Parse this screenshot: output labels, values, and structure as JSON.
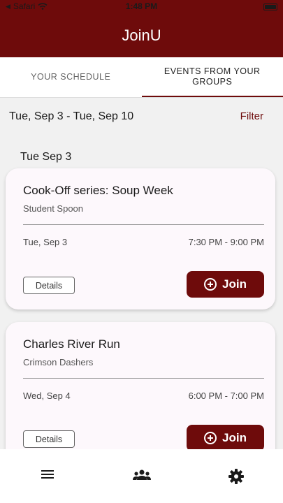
{
  "status_bar": {
    "carrier": "Safari",
    "time": "1:48 PM"
  },
  "header": {
    "title": "JoinU"
  },
  "tabs": [
    {
      "label": "YOUR SCHEDULE",
      "active": false
    },
    {
      "label": "EVENTS FROM YOUR GROUPS",
      "active": true
    }
  ],
  "range": {
    "label": "Tue, Sep 3 - Tue, Sep 10",
    "filter_label": "Filter"
  },
  "day_label": "Tue Sep 3",
  "events": [
    {
      "title": "Cook-Off series: Soup Week",
      "group": "Student Spoon",
      "date": "Tue, Sep 3",
      "time": "7:30 PM - 9:00 PM",
      "details_label": "Details",
      "join_label": "Join"
    },
    {
      "title": "Charles River Run",
      "group": "Crimson Dashers",
      "date": "Wed, Sep 4",
      "time": "6:00 PM - 7:00 PM",
      "details_label": "Details",
      "join_label": "Join"
    }
  ],
  "bottom_nav": {
    "items": [
      "menu-icon",
      "groups-icon",
      "settings-icon"
    ]
  },
  "colors": {
    "brand": "#6e0b0b",
    "background": "#f1f1f1",
    "card": "#fdf8fc"
  }
}
